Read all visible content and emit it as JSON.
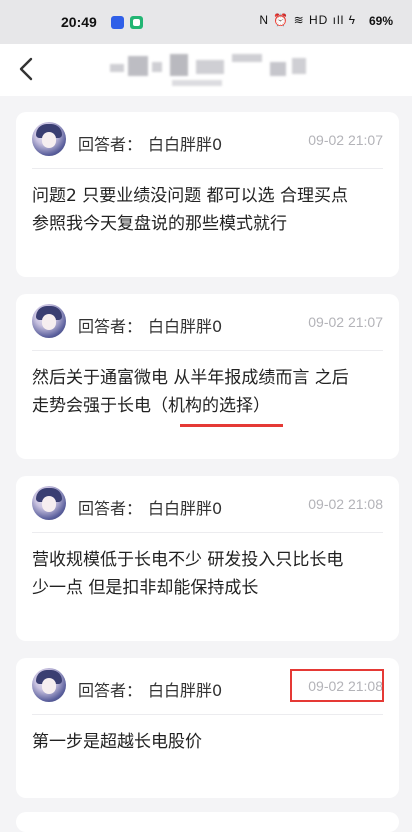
{
  "status_bar": {
    "time": "20:49",
    "icons": "N ⏰ ≋ HD ıll ϟ",
    "battery": "69%"
  },
  "nav": {
    "back_icon": "chevron-left-icon"
  },
  "cards": [
    {
      "label": "回答者：",
      "name": "白白胖胖0",
      "time": "09-02 21:07",
      "line1": "问题2 只要业绩没问题 都可以选 合理买点",
      "line2": "参照我今天复盘说的那些模式就行"
    },
    {
      "label": "回答者：",
      "name": "白白胖胖0",
      "time": "09-02 21:07",
      "line1": "然后关于通富微电 从半年报成绩而言 之后",
      "line2": "走势会强于长电（机构的选择）"
    },
    {
      "label": "回答者：",
      "name": "白白胖胖0",
      "time": "09-02 21:08",
      "line1": "营收规模低于长电不少 研发投入只比长电",
      "line2": "少一点 但是扣非却能保持成长"
    },
    {
      "label": "回答者：",
      "name": "白白胖胖0",
      "time": "09-02 21:08",
      "line1": "第一步是超越长电股价",
      "line2": ""
    }
  ],
  "annotations": {
    "color": "#e53935"
  }
}
